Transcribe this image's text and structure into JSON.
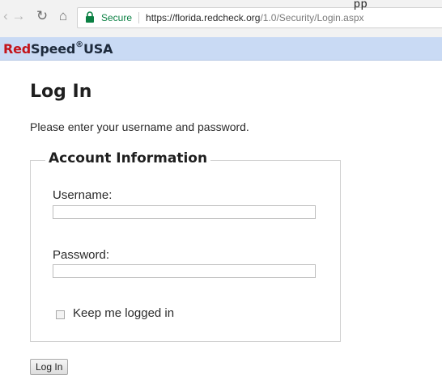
{
  "browser": {
    "back_icon": "arrow-left-icon",
    "forward_icon": "arrow-right-icon",
    "reload_icon": "reload-icon",
    "home_icon": "home-icon",
    "secure_label": "Secure",
    "url_main": "https://florida.redcheck.org",
    "url_path": "/1.0/Security/Login.aspx",
    "top_right_mark": "pp"
  },
  "brand": {
    "logo_red": "Red",
    "logo_dark": "Speed",
    "logo_reg": "®",
    "logo_suffix": "USA",
    "banner_color": "#c9daf4"
  },
  "page": {
    "title": "Log In",
    "instructions": "Please enter your username and password."
  },
  "account": {
    "legend": "Account Information",
    "username_label": "Username:",
    "password_label": "Password:",
    "username_value": "",
    "password_value": "",
    "keep_logged_in_label": "Keep me logged in",
    "keep_logged_in_checked": false
  },
  "actions": {
    "login_button": "Log In"
  }
}
